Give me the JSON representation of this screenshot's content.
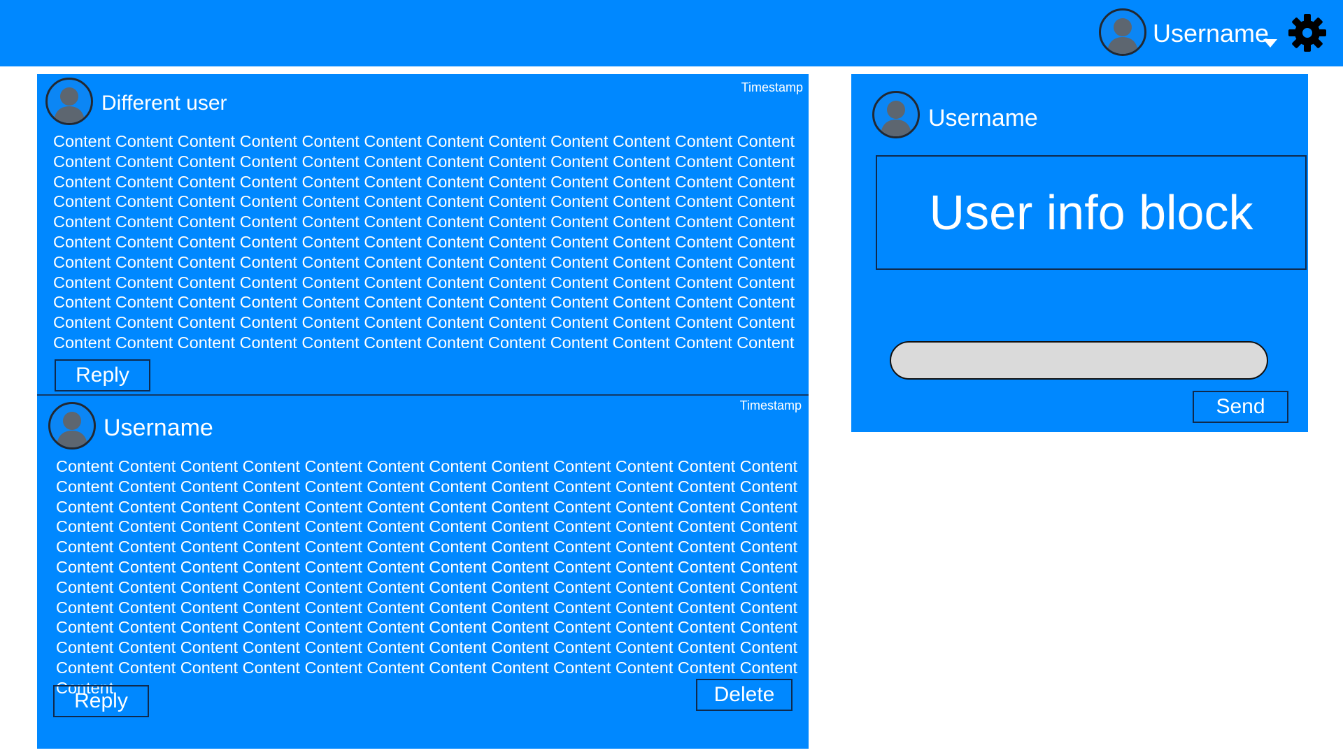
{
  "colors": {
    "primary": "#0088ff",
    "text": "#ffffff",
    "border": "#0f2a4d",
    "input_bg": "#dadada"
  },
  "header": {
    "username": "Username",
    "icons": [
      "avatar-icon",
      "chevron-down-icon",
      "gear-icon"
    ]
  },
  "posts": [
    {
      "author": "Different user",
      "timestamp": "Timestamp",
      "content": "Content Content Content Content Content Content Content Content Content Content Content Content Content Content Content Content Content Content Content Content Content Content Content Content Content Content Content Content Content Content Content Content Content Content Content Content Content Content Content Content Content Content Content Content Content Content Content Content Content Content Content Content Content Content Content Content Content Content Content Content Content Content Content Content Content Content Content Content Content Content Content Content Content Content Content Content Content Content Content Content Content Content Content Content Content Content Content Content Content Content Content Content Content Content Content Content Content Content Content Content Content Content Content Content Content Content Content Content Content Content Content Content Content Content Content Content Content Content Content Content Content Content Content Content Content Content Content Content Content Content Content Content",
      "reply_label": "Reply"
    },
    {
      "author": "Username",
      "timestamp": "Timestamp",
      "content": "Content Content Content Content Content Content Content Content Content Content Content Content Content Content Content Content Content Content Content Content Content Content Content Content Content Content Content Content Content Content Content Content Content Content Content Content Content Content Content Content Content Content Content Content Content Content Content Content Content Content Content Content Content Content Content Content Content Content Content Content Content Content Content Content Content Content Content Content Content Content Content Content Content Content Content Content Content Content Content Content Content Content Content Content Content Content Content Content Content Content Content Content Content Content Content Content Content Content Content Content Content Content Content Content Content Content Content Content Content Content Content Content Content Content Content Content Content Content Content Content Content Content Content Content Content Content Content Content Content Content Content Content Content",
      "reply_label": "Reply",
      "delete_label": "Delete"
    }
  ],
  "user_panel": {
    "username": "Username",
    "info_block": "User info block",
    "message_input": {
      "value": "",
      "placeholder": ""
    },
    "send_label": "Send"
  }
}
